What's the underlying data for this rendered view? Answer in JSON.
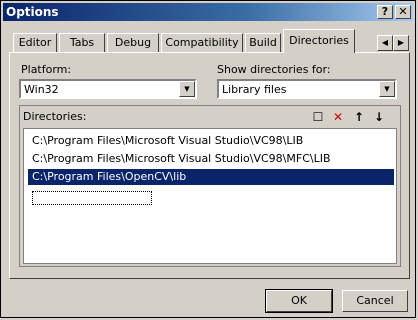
{
  "window": {
    "title": "Options",
    "help_glyph": "?",
    "close_glyph": "✕"
  },
  "tabs": [
    {
      "label": "Editor"
    },
    {
      "label": "Tabs"
    },
    {
      "label": "Debug"
    },
    {
      "label": "Compatibility"
    },
    {
      "label": "Build"
    },
    {
      "label": "Directories",
      "active": true
    }
  ],
  "tab_scroll": {
    "left": "◀",
    "right": "▶"
  },
  "platform": {
    "label": "Platform:",
    "value": "Win32"
  },
  "show_dirs": {
    "label": "Show directories for:",
    "value": "Library files"
  },
  "directories": {
    "label": "Directories:",
    "items": [
      "C:\\Program Files\\Microsoft Visual Studio\\VC98\\LIB",
      "C:\\Program Files\\Microsoft Visual Studio\\VC98\\MFC\\LIB",
      "C:\\Program Files\\OpenCV\\lib"
    ],
    "selected_index": 2,
    "icons": {
      "new": "☐",
      "delete": "✕",
      "up": "↑",
      "down": "↓"
    }
  },
  "buttons": {
    "ok": "OK",
    "cancel": "Cancel"
  },
  "colors": {
    "selection": "#0a246a",
    "title_start": "#0a246a",
    "delete_icon": "#d40000"
  }
}
